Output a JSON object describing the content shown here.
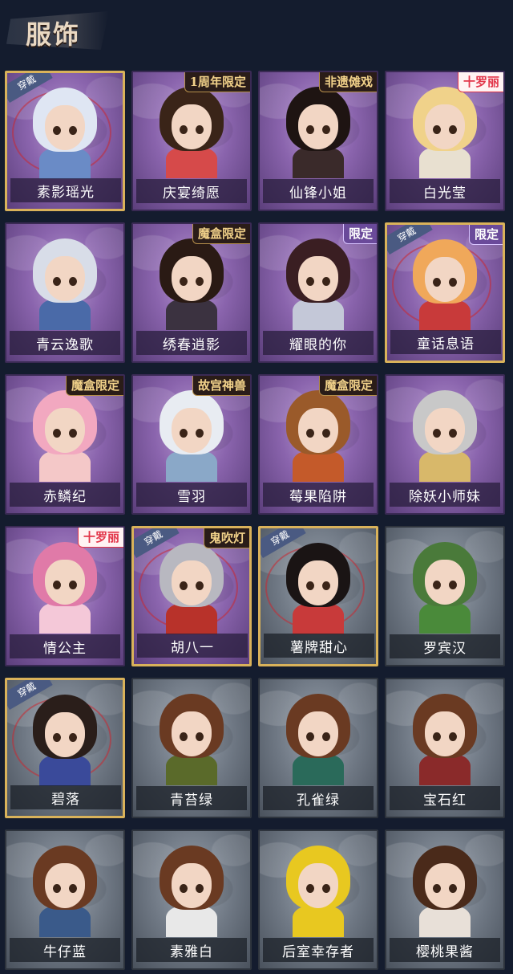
{
  "header": {
    "title": "服饰"
  },
  "items": [
    {
      "label": "素影瑶光",
      "theme": "purple",
      "worn": true,
      "badge": "",
      "badge_style": "",
      "hair": "#dfe6f3",
      "outfit": "#6a8bc6"
    },
    {
      "label": "庆宴绮愿",
      "theme": "purple",
      "worn": false,
      "badge": "1周年限定",
      "badge_style": "dark",
      "hair": "#3a2418",
      "outfit": "#d64a4a"
    },
    {
      "label": "仙锋小姐",
      "theme": "purple",
      "worn": false,
      "badge": "非遗傩戏",
      "badge_style": "dark",
      "hair": "#1e1412",
      "outfit": "#3a2a2a"
    },
    {
      "label": "白光莹",
      "theme": "purple",
      "worn": false,
      "badge": "十罗丽",
      "badge_style": "light",
      "hair": "#f0d28a",
      "outfit": "#e8e0d0"
    },
    {
      "label": "青云逸歌",
      "theme": "purple",
      "worn": false,
      "badge": "",
      "badge_style": "",
      "hair": "#d8dde8",
      "outfit": "#4a6aa8"
    },
    {
      "label": "绣春逍影",
      "theme": "purple",
      "worn": false,
      "badge": "魔盒限定",
      "badge_style": "dark",
      "hair": "#2a1a14",
      "outfit": "#3b3240"
    },
    {
      "label": "耀眼的你",
      "theme": "purple",
      "worn": false,
      "badge": "限定",
      "badge_style": "limit",
      "hair": "#3a1e22",
      "outfit": "#c4c8d8"
    },
    {
      "label": "童话息语",
      "theme": "purple",
      "worn": true,
      "badge": "限定",
      "badge_style": "limit",
      "hair": "#f0a85a",
      "outfit": "#c83a3a"
    },
    {
      "label": "赤鳞纪",
      "theme": "purple",
      "worn": false,
      "badge": "魔盒限定",
      "badge_style": "dark",
      "hair": "#f2a8c0",
      "outfit": "#f4c8c8"
    },
    {
      "label": "雪羽",
      "theme": "purple",
      "worn": false,
      "badge": "故宫神兽",
      "badge_style": "dark",
      "hair": "#e8ecf2",
      "outfit": "#8aa8c8"
    },
    {
      "label": "莓果陷阱",
      "theme": "purple",
      "worn": false,
      "badge": "魔盒限定",
      "badge_style": "dark",
      "hair": "#9a5a2a",
      "outfit": "#c45a2a"
    },
    {
      "label": "除妖小师妹",
      "theme": "purple",
      "worn": false,
      "badge": "",
      "badge_style": "",
      "hair": "#c8c8c8",
      "outfit": "#d8b86a"
    },
    {
      "label": "情公主",
      "theme": "purple",
      "worn": false,
      "badge": "十罗丽",
      "badge_style": "light",
      "hair": "#e07aa8",
      "outfit": "#f4c8d8"
    },
    {
      "label": "胡八一",
      "theme": "purple",
      "worn": true,
      "badge": "鬼吹灯",
      "badge_style": "dark",
      "hair": "#b8b8c0",
      "outfit": "#b8322a"
    },
    {
      "label": "薯牌甜心",
      "theme": "gray",
      "worn": true,
      "badge": "",
      "badge_style": "",
      "hair": "#1a1414",
      "outfit": "#c83a3a"
    },
    {
      "label": "罗宾汉",
      "theme": "gray",
      "worn": false,
      "badge": "",
      "badge_style": "",
      "hair": "#4a7a3a",
      "outfit": "#4a8a3a"
    },
    {
      "label": "碧落",
      "theme": "gray",
      "worn": true,
      "badge": "",
      "badge_style": "",
      "hair": "#2a1e1a",
      "outfit": "#3a4a9a"
    },
    {
      "label": "青苔绿",
      "theme": "gray",
      "worn": false,
      "badge": "",
      "badge_style": "",
      "hair": "#6a3a22",
      "outfit": "#5a6a2a"
    },
    {
      "label": "孔雀绿",
      "theme": "gray",
      "worn": false,
      "badge": "",
      "badge_style": "",
      "hair": "#6a3a22",
      "outfit": "#2a6a5a"
    },
    {
      "label": "宝石红",
      "theme": "gray",
      "worn": false,
      "badge": "",
      "badge_style": "",
      "hair": "#6a3a22",
      "outfit": "#8a2a2a"
    },
    {
      "label": "牛仔蓝",
      "theme": "gray",
      "worn": false,
      "badge": "",
      "badge_style": "",
      "hair": "#6a3a22",
      "outfit": "#3a5a8a"
    },
    {
      "label": "素雅白",
      "theme": "gray",
      "worn": false,
      "badge": "",
      "badge_style": "",
      "hair": "#6a3a22",
      "outfit": "#e8e8e8"
    },
    {
      "label": "后室幸存者",
      "theme": "gray",
      "worn": false,
      "badge": "",
      "badge_style": "",
      "hair": "#e8c820",
      "outfit": "#e8c820"
    },
    {
      "label": "樱桃果酱",
      "theme": "gray",
      "worn": false,
      "badge": "",
      "badge_style": "",
      "hair": "#4a2a1a",
      "outfit": "#e8e0d8"
    }
  ],
  "worn_tag_text": "穿戴"
}
